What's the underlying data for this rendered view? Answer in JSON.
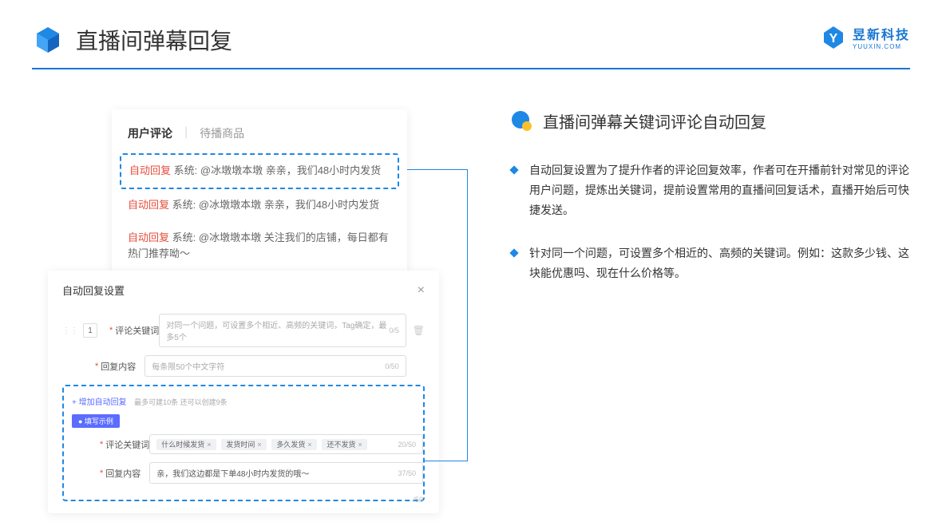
{
  "header": {
    "title": "直播间弹幕回复",
    "logo_name": "昱新科技",
    "logo_sub": "YUUXIN.COM"
  },
  "comments": {
    "tab_active": "用户评论",
    "tab_inactive": "待播商品",
    "auto_tag": "自动回复",
    "sys_label": "系统:",
    "item1": "@冰墩墩本墩 亲亲，我们48小时内发货",
    "item2": "@冰墩墩本墩 亲亲，我们48小时内发货",
    "item3": "@冰墩墩本墩 关注我们的店铺，每日都有热门推荐呦～"
  },
  "settings": {
    "title": "自动回复设置",
    "row_num": "1",
    "label_keyword": "评论关键词",
    "placeholder_keyword": "对同一个问题，可设置多个相近、高频的关键词，Tag确定，最多5个",
    "count_keyword": "0/5",
    "label_content": "回复内容",
    "placeholder_content": "每条限50个中文字符",
    "count_content": "0/50",
    "add_link": "+ 增加自动回复",
    "add_hint": "最多可建10条 还可以创建9条",
    "example_badge": "● 填写示例",
    "ex_keyword_label": "评论关键词",
    "ex_tags": [
      "什么时候发货",
      "发货时间",
      "多久发货",
      "还不发货"
    ],
    "ex_kw_count": "20/50",
    "ex_content_label": "回复内容",
    "ex_content_value": "亲，我们这边都是下单48小时内发货的哦～",
    "ex_content_count": "37/50",
    "extra_count": "/50"
  },
  "right": {
    "title": "直播间弹幕关键词评论自动回复",
    "bullet1": "自动回复设置为了提升作者的评论回复效率，作者可在开播前针对常见的评论用户问题，提炼出关键词，提前设置常用的直播间回复话术，直播开始后可快捷发送。",
    "bullet2": "针对同一个问题，可设置多个相近的、高频的关键词。例如：这款多少钱、这块能优惠吗、现在什么价格等。"
  }
}
